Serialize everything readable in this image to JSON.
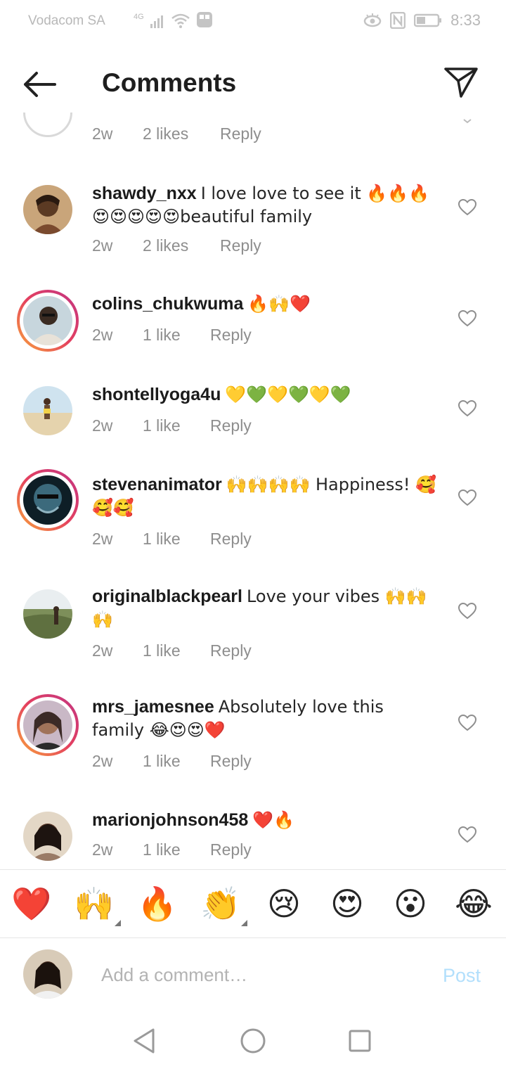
{
  "status_bar": {
    "carrier": "Vodacom SA",
    "network": "4G",
    "time": "8:33"
  },
  "header": {
    "title": "Comments"
  },
  "partial_comment": {
    "time": "2w",
    "likes": "2 likes",
    "reply": "Reply"
  },
  "comments": [
    {
      "username": "shawdy_nxx",
      "text": "I love love to see it 🔥🔥🔥😍😍😍😍😍beautiful family",
      "time": "2w",
      "likes": "2 likes",
      "reply": "Reply"
    },
    {
      "username": "colins_chukwuma",
      "text": "🔥🙌❤️",
      "time": "2w",
      "likes": "1 like",
      "reply": "Reply"
    },
    {
      "username": "shontellyoga4u",
      "text": "💛💚💛💚💛💚",
      "time": "2w",
      "likes": "1 like",
      "reply": "Reply"
    },
    {
      "username": "stevenanimator",
      "text": "🙌🙌🙌🙌 Happiness! 🥰🥰🥰",
      "time": "2w",
      "likes": "1 like",
      "reply": "Reply"
    },
    {
      "username": "originalblackpearl",
      "text": "Love your vibes 🙌🙌🙌",
      "time": "2w",
      "likes": "1 like",
      "reply": "Reply"
    },
    {
      "username": "mrs_jamesnee",
      "text": "Absolutely love this family 😂😍😍❤️",
      "time": "2w",
      "likes": "1 like",
      "reply": "Reply"
    },
    {
      "username": "marionjohnson458",
      "text": "❤️🔥",
      "time": "2w",
      "likes": "1 like",
      "reply": "Reply"
    }
  ],
  "quick_reactions": [
    "❤️",
    "🙌",
    "🔥",
    "👏",
    "😢",
    "😍",
    "😮",
    "😂"
  ],
  "compose": {
    "placeholder": "Add a comment…",
    "post_label": "Post"
  },
  "colors": {
    "ring_gradient": [
      "#f9a63a",
      "#e4405f",
      "#c13584"
    ],
    "post_disabled": "#b2dffc",
    "meta_text": "#8e8e8e"
  }
}
